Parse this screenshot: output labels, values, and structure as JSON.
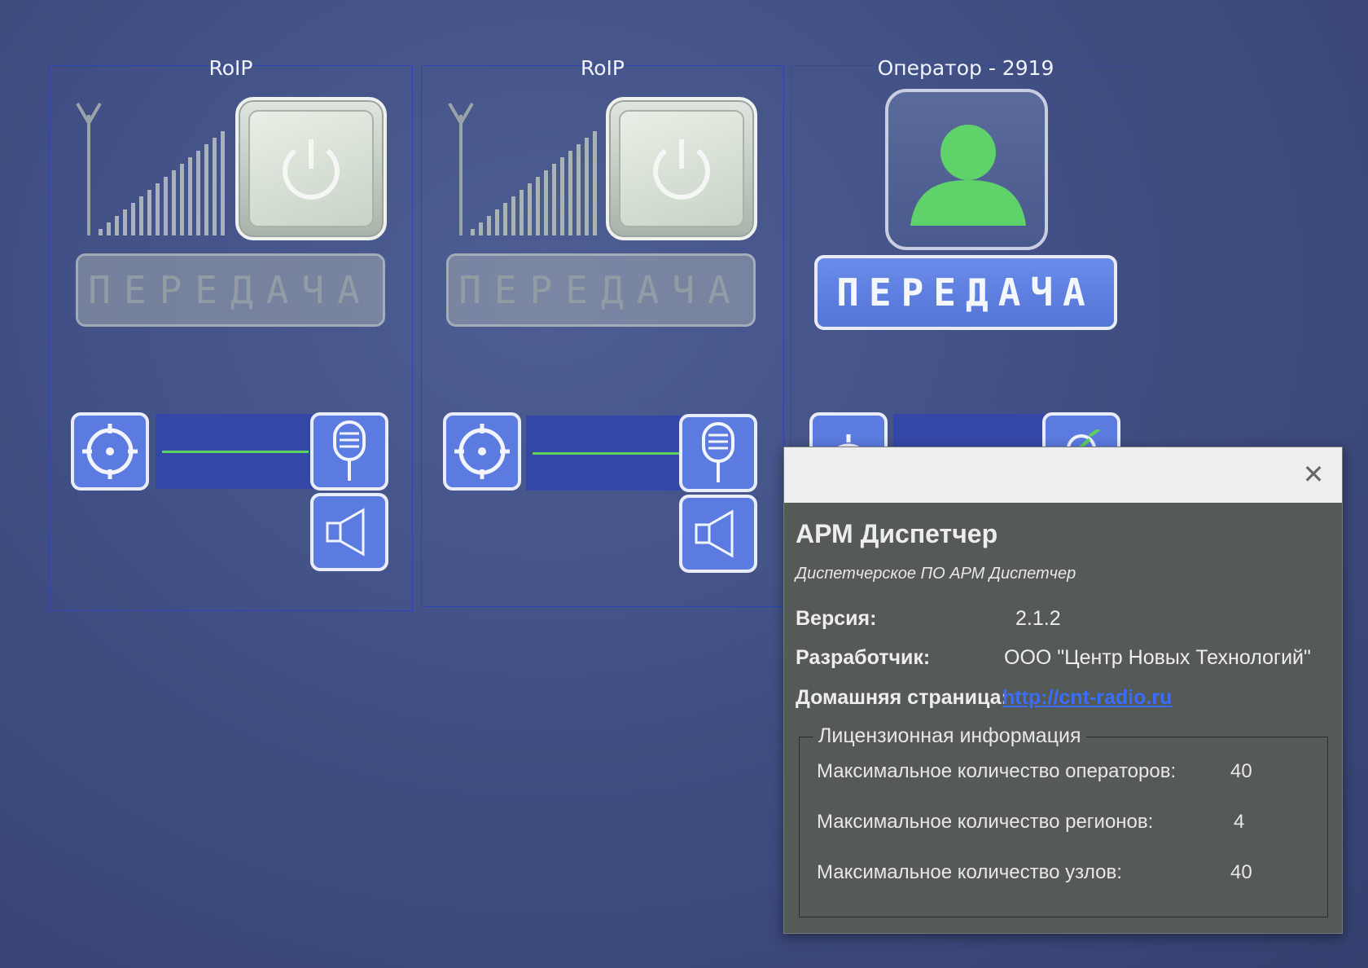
{
  "channels": [
    {
      "title": "RoIP",
      "transmit_label": "ПЕРЕДАЧА"
    },
    {
      "title": "RoIP",
      "transmit_label": "ПЕРЕДАЧА"
    }
  ],
  "operator": {
    "title": "Оператор - 2919",
    "transmit_label": "ПЕРЕДАЧА"
  },
  "colors": {
    "accent": "#5b7be0",
    "level_line": "#5ad35a",
    "avatar": "#5fd36a"
  },
  "about_dialog": {
    "close_symbol": "✕",
    "app_name": "АРМ Диспетчер",
    "description": "Диспетчерское ПО АРМ Диспетчер",
    "version_label": "Версия:",
    "version_value": "2.1.2",
    "developer_label": "Разработчик:",
    "developer_value": "ООО \"Центр Новых Технологий\"",
    "homepage_label": "Домашняя страница:",
    "homepage_value": "http://cnt-radio.ru",
    "license": {
      "legend": "Лицензионная информация",
      "rows": [
        {
          "label": "Максимальное количество операторов:",
          "value": "40"
        },
        {
          "label": "Максимальное количество регионов:",
          "value": "4"
        },
        {
          "label": "Максимальное количество узлов:",
          "value": "40"
        }
      ]
    }
  }
}
